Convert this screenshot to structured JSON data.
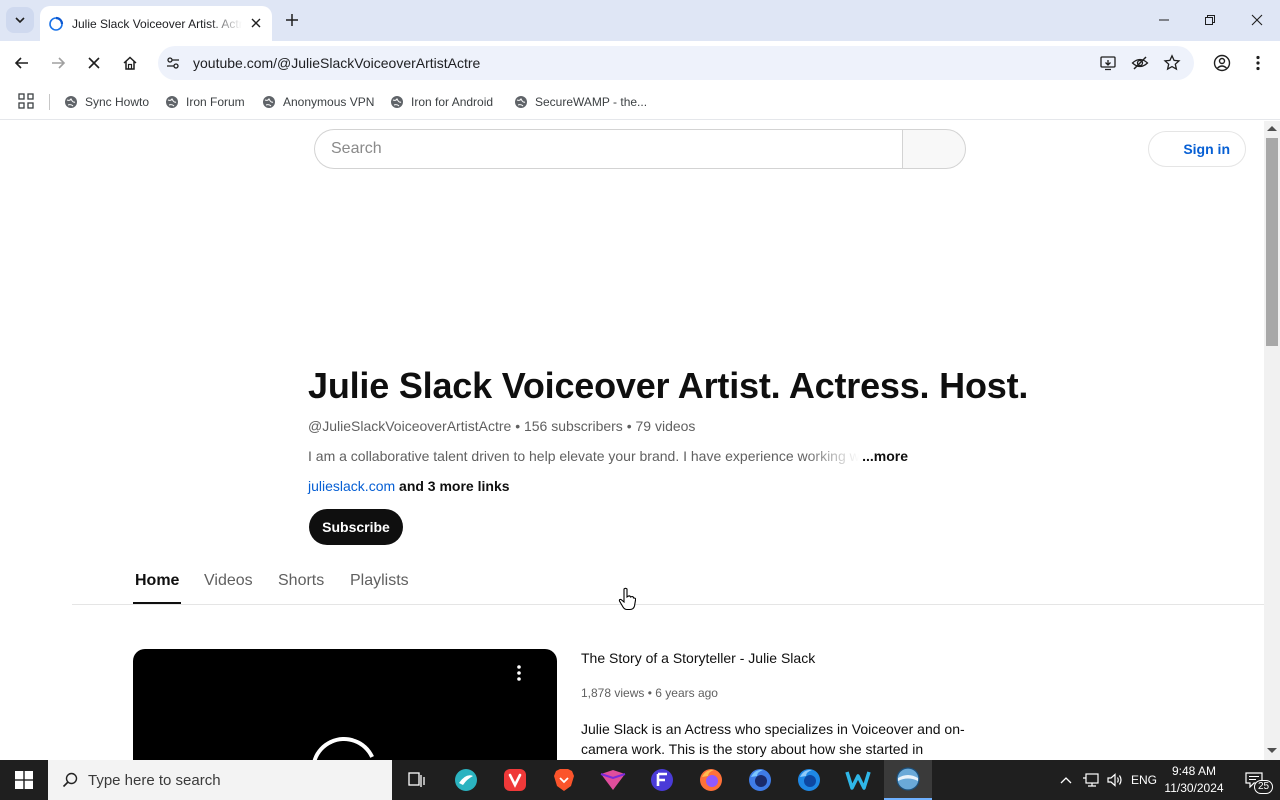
{
  "browser": {
    "tab_title": "Julie Slack Voiceover Artist. Actress. Host.",
    "url": "youtube.com/@JulieSlackVoiceoverArtistActre",
    "bookmarks": [
      {
        "label": "Sync Howto"
      },
      {
        "label": "Iron Forum"
      },
      {
        "label": "Anonymous VPN"
      },
      {
        "label": "Iron for Android"
      },
      {
        "label": "SecureWAMP - the..."
      }
    ],
    "icons": [
      "tab-list-icon",
      "close-icon",
      "plus-icon",
      "minimize-icon",
      "restore-icon",
      "back-icon",
      "forward-icon",
      "stop-icon",
      "home-icon",
      "site-settings-icon",
      "install-app-icon",
      "eye-off-icon",
      "star-icon",
      "profile-icon",
      "menu-icon"
    ]
  },
  "youtube": {
    "search_placeholder": "Search",
    "signin_label": "Sign in",
    "channel": {
      "name": "Julie Slack Voiceover Artist. Actress. Host.",
      "handle": "@JulieSlackVoiceoverArtistActre",
      "subscribers": "156 subscribers",
      "videos": "79 videos",
      "separator": "•",
      "description": "I am a collaborative talent driven to help elevate your brand. I have experience working with",
      "more_label": "...more",
      "link": "julieslack.com",
      "more_links": "and 3 more links",
      "subscribe_label": "Subscribe"
    },
    "tabs": [
      {
        "label": "Home",
        "active": true
      },
      {
        "label": "Videos",
        "active": false
      },
      {
        "label": "Shorts",
        "active": false
      },
      {
        "label": "Playlists",
        "active": false
      }
    ],
    "featured_video": {
      "title": "The Story of a Storyteller - Julie Slack",
      "views": "1,878 views",
      "age": "6 years ago",
      "description": "Julie Slack is an Actress who specializes in Voiceover and on-camera work. This is the story about how she started in"
    }
  },
  "taskbar": {
    "search_placeholder": "Type here to search",
    "language": "ENG",
    "time": "9:48 AM",
    "date": "11/30/2024",
    "notification_count": "25"
  },
  "colors": {
    "accent_link": "#065fd4",
    "subscribe_bg": "#0f0f0f",
    "tabstrip_bg": "#dfe6f5",
    "taskbar_bg": "#1f1f1f"
  }
}
